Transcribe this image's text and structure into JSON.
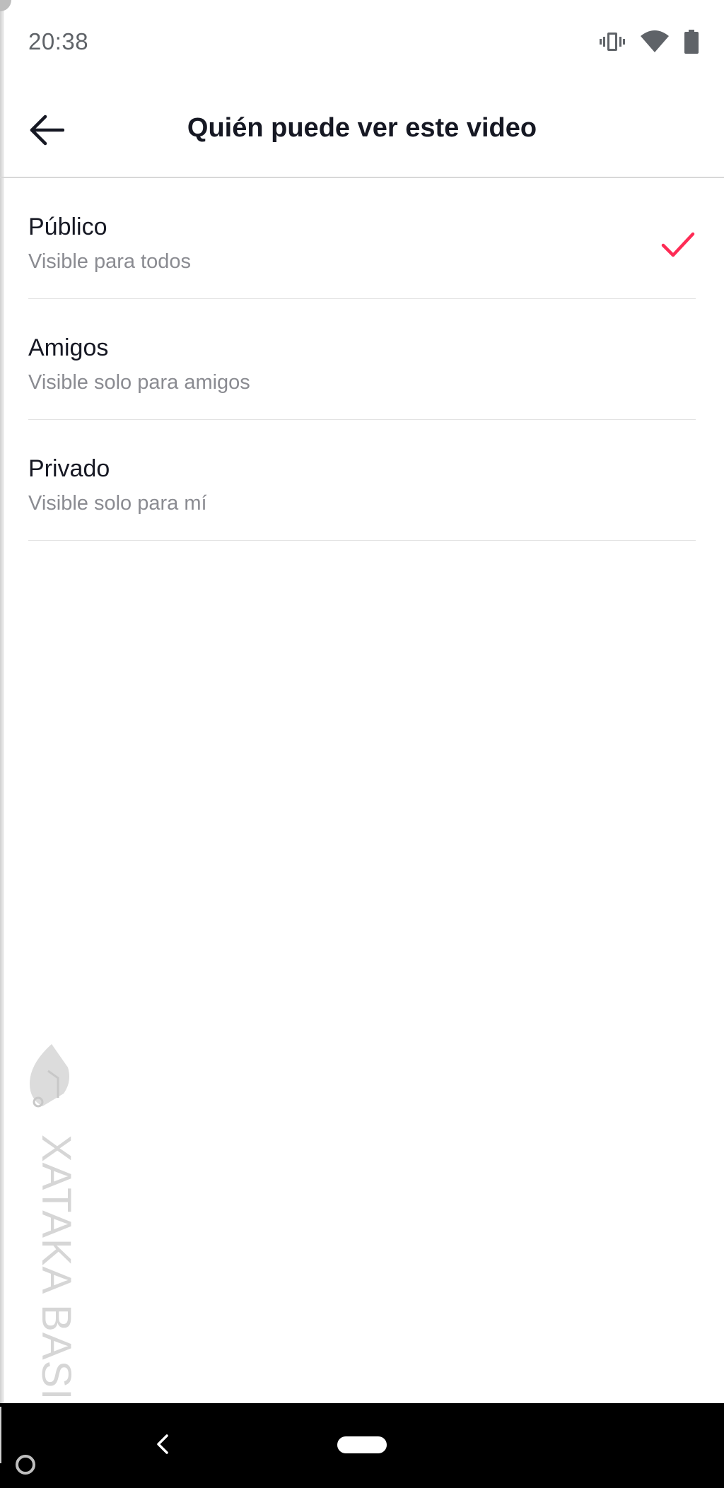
{
  "status_bar": {
    "time": "20:38",
    "icons": [
      "vibrate-icon",
      "wifi-icon",
      "battery-icon"
    ]
  },
  "header": {
    "back_icon": "arrow-left-icon",
    "title": "Quién puede ver este video"
  },
  "options": [
    {
      "title": "Público",
      "subtitle": "Visible para todos",
      "selected": true
    },
    {
      "title": "Amigos",
      "subtitle": "Visible solo para amigos",
      "selected": false
    },
    {
      "title": "Privado",
      "subtitle": "Visible solo para mí",
      "selected": false
    }
  ],
  "watermark": {
    "text": "XATAKA BASICS"
  },
  "colors": {
    "accent": "#fe2c55",
    "title_text": "#161823",
    "subtitle_text": "#8a8b91",
    "divider": "#e3e3e3"
  },
  "nav_bar": {
    "icons": [
      "nav-back-icon",
      "home-pill-icon"
    ]
  }
}
